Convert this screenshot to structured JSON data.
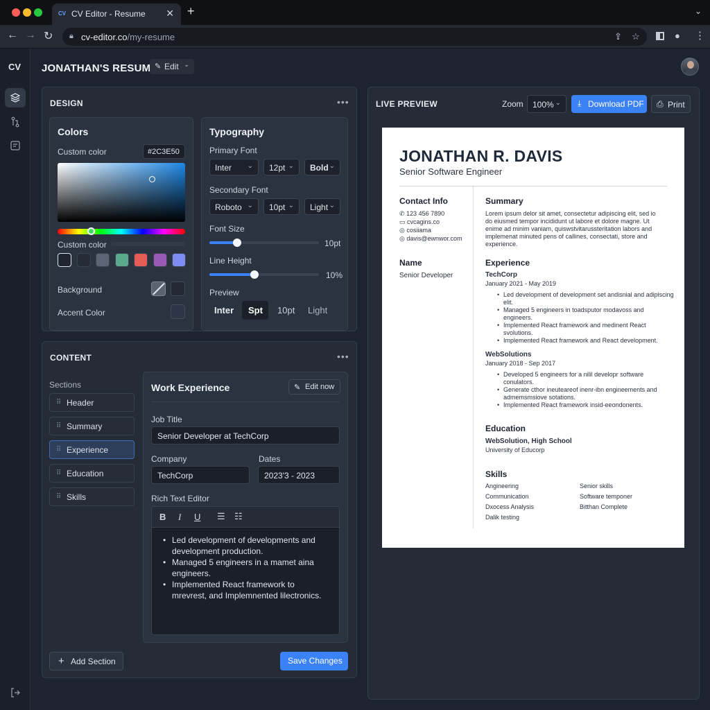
{
  "browser": {
    "tab_title": "CV Editor - Resume",
    "tab_favicon": "CV",
    "url_domain": "cv-editor.co",
    "url_path": "/my-resume"
  },
  "app": {
    "logo": "CV",
    "page_title": "JONATHAN'S RESUME",
    "edit_label": "Edit"
  },
  "design": {
    "title": "DESIGN",
    "colors": {
      "title": "Colors",
      "custom_color_label": "Custom color",
      "hex_value": "#2C3E50",
      "custom_color_label2": "Custom color",
      "background_label": "Background",
      "accent_label": "Accent Color",
      "swatches": [
        "#1f2530",
        "#252c37",
        "#5b6473",
        "#5aa98a",
        "#e55c56",
        "#9b59b6",
        "#7c8cf0"
      ]
    },
    "typography": {
      "title": "Typography",
      "primary_font_label": "Primary Font",
      "primary_font": "Inter",
      "primary_size": "12pt",
      "primary_weight": "Bold",
      "secondary_font_label": "Secondary Font",
      "secondary_font": "Roboto",
      "secondary_size": "10pt",
      "secondary_weight": "Light",
      "font_size_label": "Font Size",
      "font_size_value": "10pt",
      "font_size_level": 0.25,
      "line_height_label": "Line Height",
      "line_height_value": "10%",
      "line_height_level": 0.41,
      "preview_label": "Preview",
      "preview_items": [
        "Inter",
        "Spt",
        "10pt",
        "Light"
      ]
    }
  },
  "content": {
    "title": "CONTENT",
    "sections_label": "Sections",
    "sections": [
      "Header",
      "Summary",
      "Experience",
      "Education",
      "Skills"
    ],
    "active_section": "Experience",
    "editor": {
      "title": "Work Experience",
      "edit_button": "Edit now",
      "job_title_label": "Job Title",
      "job_title_value": "Senior Developer at TechCorp",
      "company_label": "Company",
      "company_value": "TechCorp",
      "dates_label": "Dates",
      "dates_value": "2023'3 - 2023",
      "rich_text_label": "Rich Text Editor",
      "bullets": [
        "Led development of developments and development production.",
        "Managed 5 engineers in a mamet aina engineers.",
        "Implemented React framework to mrevrest, and Implemnented lilectronics."
      ]
    },
    "add_section": "Add Section",
    "save_changes": "Save Changes"
  },
  "preview": {
    "title": "LIVE PREVIEW",
    "zoom_label": "Zoom",
    "zoom_value": "100%",
    "download_label": "Download PDF",
    "print_label": "Print"
  },
  "resume": {
    "name": "JONATHAN R. DAVIS",
    "role": "Senior Software Engineer",
    "contact_title": "Contact Info",
    "phone": "123 456 7890",
    "website": "cvcagins.co",
    "handle": "cosiiama",
    "email": "davis@ewnwor.com",
    "name_title": "Name",
    "name_value": "Senior Developer",
    "summary_title": "Summary",
    "summary_lines": [
      "Lorem ipsum delor sit amet, consectetur adipiscing elit, sed io",
      "do eiusmed tempor incididunt ut labore et dolore magne. Ut",
      "enime ad minim vaniam, quiswstvitarussteritation labors and",
      "implemenat minuted pens of callines, consectati, store and",
      "experience."
    ],
    "experience_title": "Experience",
    "jobs": [
      {
        "company": "TechCorp",
        "dates": "January 2021 - May 2019",
        "bullets": [
          "Led development of development set andisnial and adipiscing elit.",
          "Managed 5 engineers in toadsputor modavoss and engineers.",
          "Implemented React framework and medinent React svolutions.",
          "Implemented React framework and React development."
        ]
      },
      {
        "company": "WebSolutions",
        "dates": "January 2018 - Sep 2017",
        "bullets": [
          "Developed 5 engineers for a nilil developr software conulators.",
          "Generate cthor ineuteareof inenr-ibn engineements and admemsmsiove sotations.",
          "Implemented React framework insid-eeondonents."
        ]
      }
    ],
    "education_title": "Education",
    "school": "WebSolution, High School",
    "university": "University of Educorp",
    "skills_title": "Skills",
    "skills_left": [
      "Angineering",
      "Communication",
      "Dxocess Analysis",
      "Dalik testing"
    ],
    "skills_right": [
      "Senior skills",
      "Software temponer",
      "Bitthan Complete"
    ]
  }
}
